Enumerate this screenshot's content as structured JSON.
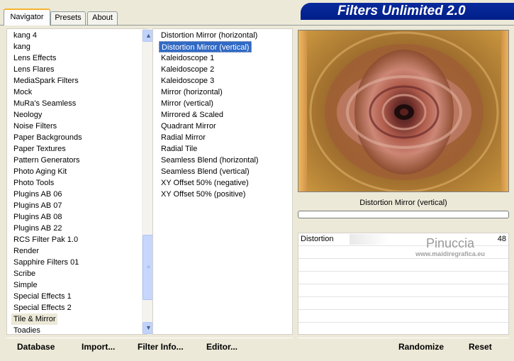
{
  "tabs": [
    {
      "label": "Navigator"
    },
    {
      "label": "Presets"
    },
    {
      "label": "About"
    }
  ],
  "app_title": "Filters Unlimited 2.0",
  "categories": [
    "kang 4",
    "kang",
    "Lens Effects",
    "Lens Flares",
    "MediaSpark Filters",
    "Mock",
    "MuRa's Seamless",
    "Neology",
    "Noise Filters",
    "Paper Backgrounds",
    "Paper Textures",
    "Pattern Generators",
    "Photo Aging Kit",
    "Photo Tools",
    "Plugins AB 06",
    "Plugins AB 07",
    "Plugins AB 08",
    "Plugins AB 22",
    "RCS Filter Pak 1.0",
    "Render",
    "Sapphire Filters 01",
    "Scribe",
    "Simple",
    "Special Effects 1",
    "Special Effects 2",
    "Tile & Mirror",
    "Toadies"
  ],
  "selected_category": "Tile & Mirror",
  "filters": [
    "Distortion Mirror (horizontal)",
    "Distortion Mirror (vertical)",
    "Kaleidoscope 1",
    "Kaleidoscope 2",
    "Kaleidoscope 3",
    "Mirror (horizontal)",
    "Mirror (vertical)",
    "Mirrored & Scaled",
    "Quadrant Mirror",
    "Radial Mirror",
    "Radial Tile",
    "Seamless Blend (horizontal)",
    "Seamless Blend (vertical)",
    "XY Offset 50% (negative)",
    "XY Offset 50% (positive)"
  ],
  "selected_filter": "Distortion Mirror (vertical)",
  "preview_label": "Distortion Mirror (vertical)",
  "parameters": [
    {
      "name": "Distortion",
      "value": "48",
      "fraction": 0.19
    }
  ],
  "watermark": {
    "name": "Pinuccia",
    "site": "www.maidiregrafica.eu"
  },
  "buttons": {
    "database": "Database",
    "import": "Import...",
    "filter_info": "Filter Info...",
    "editor": "Editor...",
    "randomize": "Randomize",
    "reset": "Reset"
  },
  "colors": {
    "banner": "#0a2a9c",
    "selection": "#316ac5",
    "tab_accent": "#f8b331"
  }
}
